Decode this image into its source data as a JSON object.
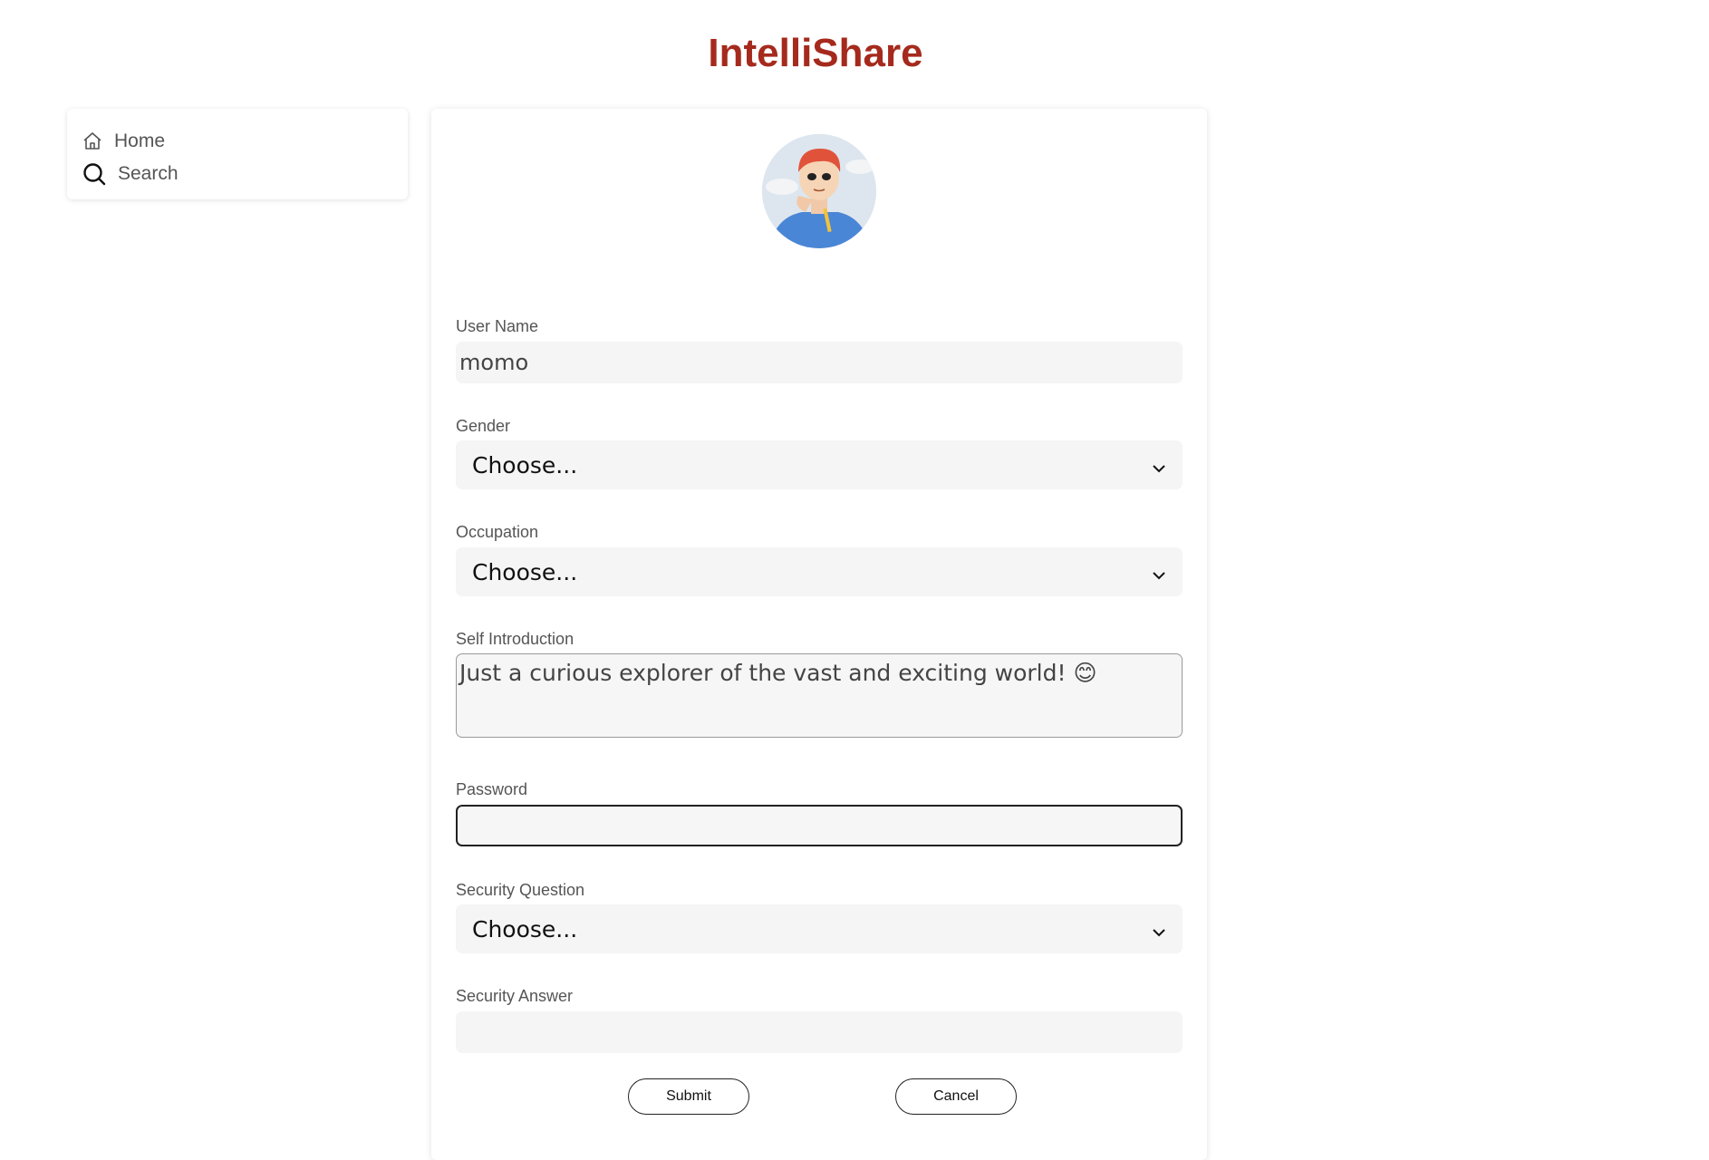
{
  "app": {
    "title": "IntelliShare",
    "brand_color": "#a52a1d"
  },
  "sidebar": {
    "items": [
      {
        "label": "Home",
        "icon": "home-icon"
      },
      {
        "label": "Search",
        "icon": "search-icon"
      }
    ]
  },
  "form": {
    "username": {
      "label": "User Name",
      "value": "momo"
    },
    "gender": {
      "label": "Gender",
      "selected": "Choose..."
    },
    "occupation": {
      "label": "Occupation",
      "selected": "Choose..."
    },
    "self_intro": {
      "label": "Self Introduction",
      "value": "Just a curious explorer of the vast and exciting world! 😊"
    },
    "password": {
      "label": "Password",
      "value": ""
    },
    "security_question": {
      "label": "Security Question",
      "selected": "Choose..."
    },
    "security_answer": {
      "label": "Security Answer",
      "value": ""
    },
    "submit_label": "Submit",
    "cancel_label": "Cancel"
  }
}
